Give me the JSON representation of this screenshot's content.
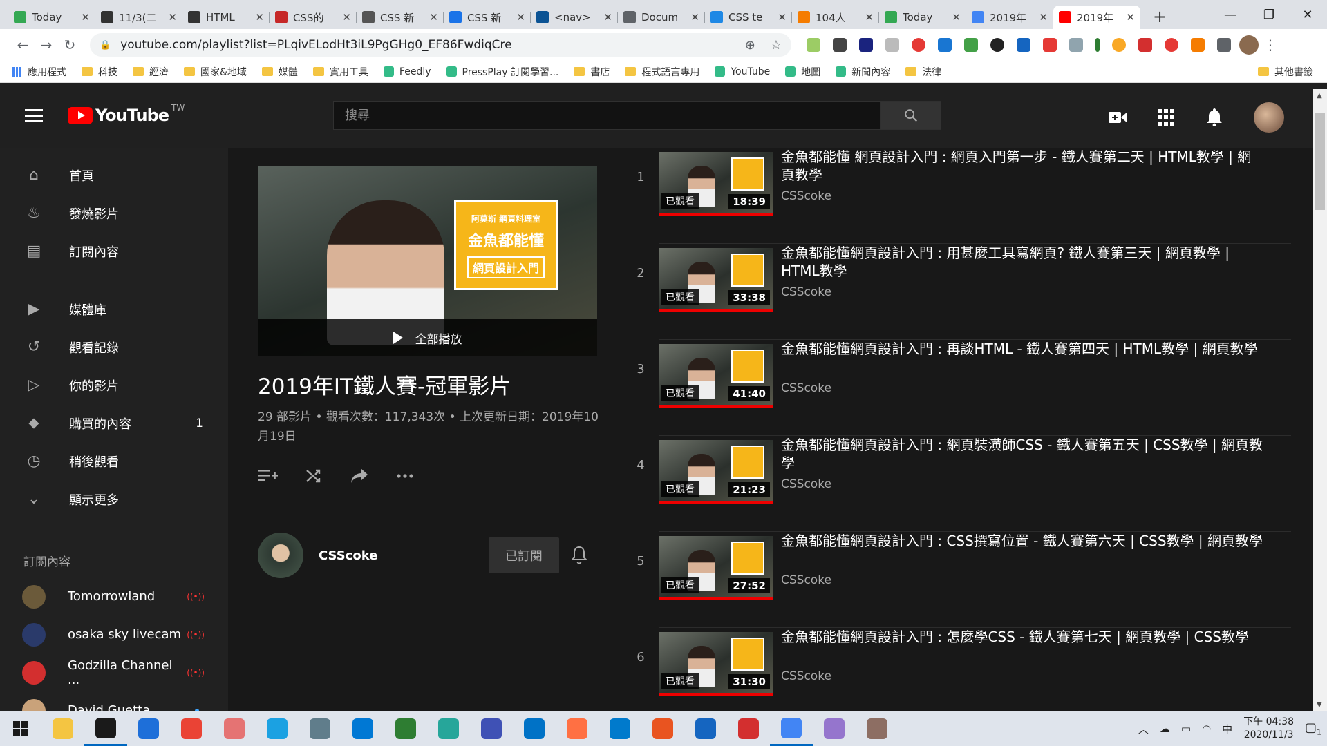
{
  "browser": {
    "tabs": [
      {
        "title": "Today",
        "color": "#34a853",
        "active": false
      },
      {
        "title": "11/3(二",
        "color": "#333333",
        "active": false
      },
      {
        "title": "HTML",
        "color": "#333333",
        "active": false
      },
      {
        "title": "CSS的",
        "color": "#c62828",
        "active": false
      },
      {
        "title": "CSS 新",
        "color": "#555555",
        "active": false
      },
      {
        "title": "CSS 新",
        "color": "#1a73e8",
        "active": false
      },
      {
        "title": "<nav>",
        "color": "#0b5394",
        "active": false
      },
      {
        "title": "Docum",
        "color": "#5f6368",
        "active": false
      },
      {
        "title": "CSS te",
        "color": "#1e88e5",
        "active": false
      },
      {
        "title": "104人",
        "color": "#f57c00",
        "active": false
      },
      {
        "title": "Today",
        "color": "#34a853",
        "active": false
      },
      {
        "title": "2019年",
        "color": "#4285f4",
        "active": false
      },
      {
        "title": "2019年",
        "color": "#ff0000",
        "active": true
      }
    ],
    "new_tab": "+",
    "url": "youtube.com/playlist?list=PLqivELodHt3iL9PgGHg0_EF86FwdiqCre",
    "bookmarks": [
      {
        "label": "應用程式",
        "type": "apps"
      },
      {
        "label": "科技",
        "type": "folder"
      },
      {
        "label": "經濟",
        "type": "folder"
      },
      {
        "label": "國家&地域",
        "type": "folder"
      },
      {
        "label": "媒體",
        "type": "folder"
      },
      {
        "label": "實用工具",
        "type": "folder"
      },
      {
        "label": "Feedly",
        "type": "link"
      },
      {
        "label": "PressPlay 訂閱學習...",
        "type": "link"
      },
      {
        "label": "書店",
        "type": "folder"
      },
      {
        "label": "程式語言專用",
        "type": "folder"
      },
      {
        "label": "YouTube",
        "type": "link"
      },
      {
        "label": "地圖",
        "type": "link"
      },
      {
        "label": "新聞內容",
        "type": "link"
      },
      {
        "label": "法律",
        "type": "folder"
      }
    ],
    "other_bookmarks": "其他書籤"
  },
  "youtube": {
    "logo_text": "YouTube",
    "logo_region": "TW",
    "search_placeholder": "搜尋",
    "sidebar": {
      "main": [
        {
          "label": "首頁",
          "icon": "home-icon"
        },
        {
          "label": "發燒影片",
          "icon": "trending-icon"
        },
        {
          "label": "訂閱內容",
          "icon": "subscriptions-icon"
        }
      ],
      "library": [
        {
          "label": "媒體庫",
          "icon": "library-icon"
        },
        {
          "label": "觀看記錄",
          "icon": "history-icon"
        },
        {
          "label": "你的影片",
          "icon": "your-videos-icon"
        },
        {
          "label": "購買的內容",
          "icon": "purchases-icon",
          "count": "1"
        },
        {
          "label": "稍後觀看",
          "icon": "watch-later-icon"
        },
        {
          "label": "顯示更多",
          "icon": "chevron-down-icon"
        }
      ],
      "subscriptions_heading": "訂閱內容",
      "subscriptions": [
        {
          "name": "Tomorrowland",
          "status": "live",
          "color": "#6b5a3a"
        },
        {
          "name": "osaka sky livecam",
          "status": "live",
          "color": "#2a3a6a"
        },
        {
          "name": "Godzilla Channel ...",
          "status": "live",
          "color": "#d32f2f"
        },
        {
          "name": "David Guetta",
          "status": "new",
          "color": "#c9a27a"
        }
      ]
    },
    "playlist": {
      "play_all": "全部播放",
      "title": "2019年IT鐵人賽-冠軍影片",
      "stats": "29 部影片 • 觀看次數：117,343次 • 上次更新日期：2019年10月19日",
      "owner": "CSScoke",
      "subscribe_label": "已訂閱",
      "thumb_badge": {
        "line1": "阿莫斯 網頁料理室",
        "line2": "金魚都能懂",
        "line3": "網頁設計入門"
      }
    },
    "videos": [
      {
        "index": "1",
        "title": "金魚都能懂 網頁設計入門 : 網頁入門第一步 - 鐵人賽第二天 | HTML教學 | 網頁教學",
        "channel": "CSScoke",
        "duration": "18:39",
        "watched": "已觀看"
      },
      {
        "index": "2",
        "title": "金魚都能懂網頁設計入門 : 用甚麼工具寫網頁? 鐵人賽第三天 | 網頁教學 | HTML教學",
        "channel": "CSScoke",
        "duration": "33:38",
        "watched": "已觀看"
      },
      {
        "index": "3",
        "title": "金魚都能懂網頁設計入門 : 再談HTML - 鐵人賽第四天 | HTML教學 | 網頁教學",
        "channel": "CSScoke",
        "duration": "41:40",
        "watched": "已觀看"
      },
      {
        "index": "4",
        "title": "金魚都能懂網頁設計入門 : 網頁裝潢師CSS - 鐵人賽第五天 | CSS教學 | 網頁教學",
        "channel": "CSScoke",
        "duration": "21:23",
        "watched": "已觀看"
      },
      {
        "index": "5",
        "title": "金魚都能懂網頁設計入門 : CSS撰寫位置 - 鐵人賽第六天 | CSS教學 | 網頁教學",
        "channel": "CSScoke",
        "duration": "27:52",
        "watched": "已觀看"
      },
      {
        "index": "6",
        "title": "金魚都能懂網頁設計入門 : 怎麼學CSS - 鐵人賽第七天 | 網頁教學 | CSS教學",
        "channel": "CSScoke",
        "duration": "31:30",
        "watched": "已觀看"
      }
    ]
  },
  "taskbar": {
    "apps": [
      "#f4c542",
      "#1a1a1a",
      "#1e6fd9",
      "#ea4335",
      "#e57373",
      "#1ba1e2",
      "#607d8b",
      "#0078d4",
      "#2e7d32",
      "#26a69a",
      "#3f51b5",
      "#0072c6",
      "#ff7043",
      "#007acc",
      "#e95420",
      "#1565c0",
      "#d32f2f",
      "#4285f4",
      "#9575cd",
      "#8d6e63"
    ],
    "ime": "中",
    "time": "下午 04:38",
    "date": "2020/11/3",
    "notifications": "1"
  }
}
